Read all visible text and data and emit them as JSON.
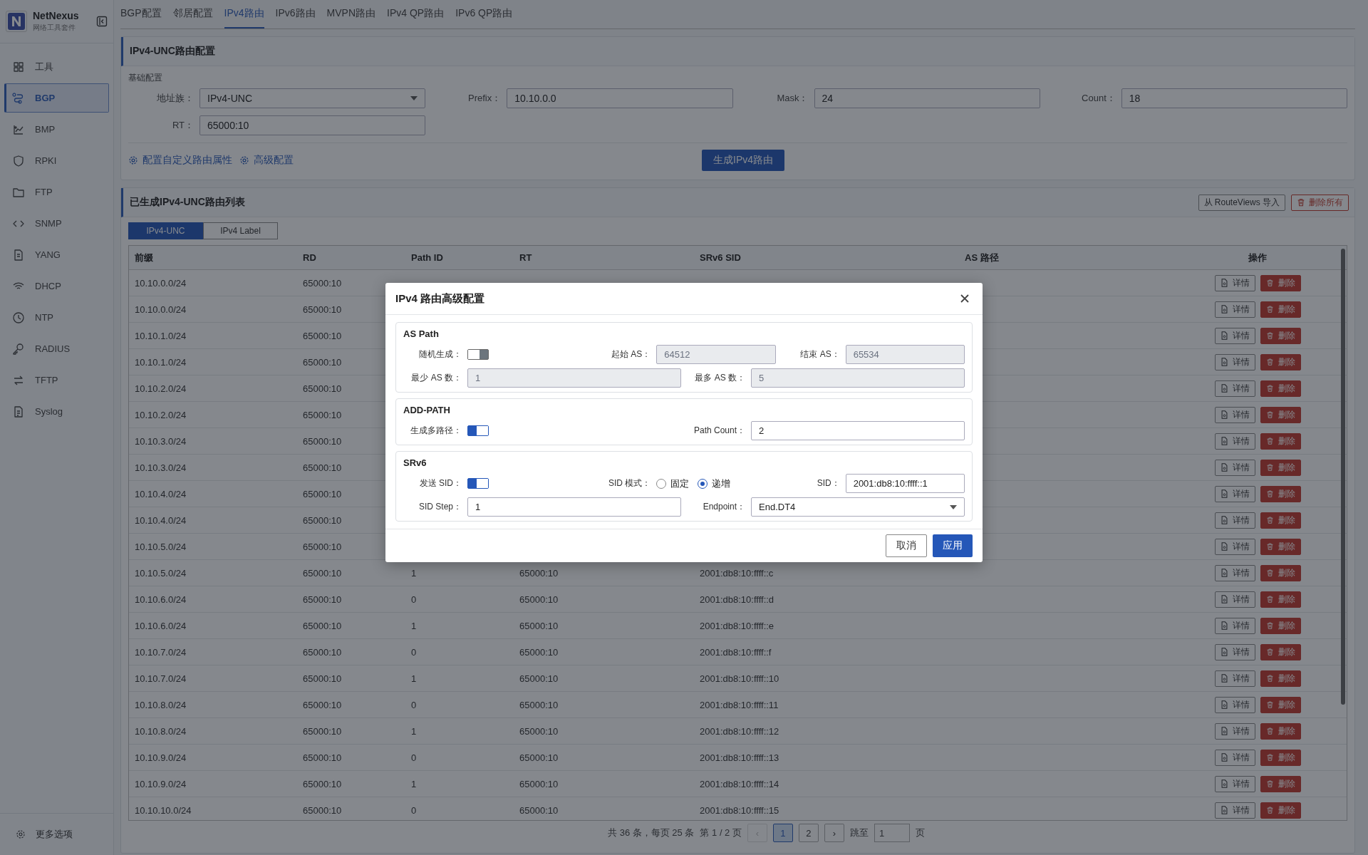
{
  "app": {
    "name": "NetNexus",
    "subtitle": "网络工具套件"
  },
  "sidebar": {
    "items": [
      {
        "label": "工具",
        "selected": false
      },
      {
        "label": "BGP",
        "selected": true
      },
      {
        "label": "BMP",
        "selected": false
      },
      {
        "label": "RPKI",
        "selected": false
      },
      {
        "label": "FTP",
        "selected": false
      },
      {
        "label": "SNMP",
        "selected": false
      },
      {
        "label": "YANG",
        "selected": false
      },
      {
        "label": "DHCP",
        "selected": false
      },
      {
        "label": "NTP",
        "selected": false
      },
      {
        "label": "RADIUS",
        "selected": false
      },
      {
        "label": "TFTP",
        "selected": false
      },
      {
        "label": "Syslog",
        "selected": false
      }
    ],
    "footer": "更多选项"
  },
  "tabs": [
    {
      "label": "BGP配置",
      "selected": false
    },
    {
      "label": "邻居配置",
      "selected": false
    },
    {
      "label": "IPv4路由",
      "selected": true
    },
    {
      "label": "IPv6路由",
      "selected": false
    },
    {
      "label": "MVPN路由",
      "selected": false
    },
    {
      "label": "IPv4 QP路由",
      "selected": false
    },
    {
      "label": "IPv6 QP路由",
      "selected": false
    }
  ],
  "config_card": {
    "title": "IPv4-UNC路由配置",
    "section": "基础配置",
    "fields": [
      {
        "kind": "select",
        "label": "地址族：",
        "value": "IPv4-UNC"
      },
      {
        "kind": "input",
        "label": "Prefix：",
        "value": "10.10.0.0"
      },
      {
        "kind": "input",
        "label": "Mask：",
        "value": "24"
      },
      {
        "kind": "input",
        "label": "Count：",
        "value": "18"
      },
      {
        "kind": "input",
        "label": "RT：",
        "value": "65000:10"
      }
    ],
    "links": [
      "配置自定义路由属性",
      "高级配置"
    ],
    "generate_button": "生成IPv4路由"
  },
  "list_card": {
    "title": "已生成IPv4-UNC路由列表",
    "import_button": "从 RouteViews 导入",
    "delete_all_button": "删除所有",
    "subtabs": [
      {
        "label": "IPv4-UNC",
        "selected": true
      },
      {
        "label": "IPv4 Label",
        "selected": false
      }
    ],
    "table": {
      "columns": [
        "前缀",
        "RD",
        "Path ID",
        "RT",
        "SRv6 SID",
        "AS 路径",
        "操作"
      ],
      "rows": [
        {
          "prefix": "10.10.0.0/24",
          "rd": "65000:10",
          "actions": [
            "详情",
            "删除"
          ]
        },
        {
          "prefix": "10.10.0.0/24",
          "rd": "65000:10",
          "actions": [
            "详情",
            "删除"
          ]
        },
        {
          "prefix": "10.10.1.0/24",
          "rd": "65000:10",
          "actions": [
            "详情",
            "删除"
          ]
        },
        {
          "prefix": "10.10.1.0/24",
          "rd": "65000:10",
          "actions": [
            "详情",
            "删除"
          ]
        },
        {
          "prefix": "10.10.2.0/24",
          "rd": "65000:10",
          "actions": [
            "详情",
            "删除"
          ]
        },
        {
          "prefix": "10.10.2.0/24",
          "rd": "65000:10",
          "actions": [
            "详情",
            "删除"
          ]
        },
        {
          "prefix": "10.10.3.0/24",
          "rd": "65000:10",
          "actions": [
            "详情",
            "删除"
          ]
        },
        {
          "prefix": "10.10.3.0/24",
          "rd": "65000:10",
          "actions": [
            "详情",
            "删除"
          ]
        },
        {
          "prefix": "10.10.4.0/24",
          "rd": "65000:10",
          "actions": [
            "详情",
            "删除"
          ]
        },
        {
          "prefix": "10.10.4.0/24",
          "rd": "65000:10",
          "actions": [
            "详情",
            "删除"
          ]
        },
        {
          "prefix": "10.10.5.0/24",
          "rd": "65000:10",
          "actions": [
            "详情",
            "删除"
          ]
        },
        {
          "prefix": "10.10.5.0/24",
          "rd": "65000:10",
          "path_id": "1",
          "rt": "65000:10",
          "sid": "2001:db8:10:ffff::c",
          "actions": [
            "详情",
            "删除"
          ]
        },
        {
          "prefix": "10.10.6.0/24",
          "rd": "65000:10",
          "path_id": "0",
          "rt": "65000:10",
          "sid": "2001:db8:10:ffff::d",
          "actions": [
            "详情",
            "删除"
          ]
        },
        {
          "prefix": "10.10.6.0/24",
          "rd": "65000:10",
          "path_id": "1",
          "rt": "65000:10",
          "sid": "2001:db8:10:ffff::e",
          "actions": [
            "详情",
            "删除"
          ]
        },
        {
          "prefix": "10.10.7.0/24",
          "rd": "65000:10",
          "path_id": "0",
          "rt": "65000:10",
          "sid": "2001:db8:10:ffff::f",
          "actions": [
            "详情",
            "删除"
          ]
        },
        {
          "prefix": "10.10.7.0/24",
          "rd": "65000:10",
          "path_id": "1",
          "rt": "65000:10",
          "sid": "2001:db8:10:ffff::10",
          "actions": [
            "详情",
            "删除"
          ]
        },
        {
          "prefix": "10.10.8.0/24",
          "rd": "65000:10",
          "path_id": "0",
          "rt": "65000:10",
          "sid": "2001:db8:10:ffff::11",
          "actions": [
            "详情",
            "删除"
          ]
        },
        {
          "prefix": "10.10.8.0/24",
          "rd": "65000:10",
          "path_id": "1",
          "rt": "65000:10",
          "sid": "2001:db8:10:ffff::12",
          "actions": [
            "详情",
            "删除"
          ]
        },
        {
          "prefix": "10.10.9.0/24",
          "rd": "65000:10",
          "path_id": "0",
          "rt": "65000:10",
          "sid": "2001:db8:10:ffff::13",
          "actions": [
            "详情",
            "删除"
          ]
        },
        {
          "prefix": "10.10.9.0/24",
          "rd": "65000:10",
          "path_id": "1",
          "rt": "65000:10",
          "sid": "2001:db8:10:ffff::14",
          "actions": [
            "详情",
            "删除"
          ]
        },
        {
          "prefix": "10.10.10.0/24",
          "rd": "65000:10",
          "path_id": "0",
          "rt": "65000:10",
          "sid": "2001:db8:10:ffff::15",
          "actions": [
            "详情",
            "删除"
          ]
        }
      ]
    },
    "pagination": {
      "summary": "共 36 条，每页 25 条",
      "page_info": "第 1 / 2 页",
      "prev": "‹",
      "prev_disabled": true,
      "pages": [
        {
          "label": "1",
          "selected": true
        },
        {
          "label": "2",
          "selected": false
        }
      ],
      "next": "›",
      "jump_label": "跳至",
      "jump_value": "1",
      "jump_suffix": "页"
    }
  },
  "modal": {
    "title": "IPv4 路由高级配置",
    "sections": [
      {
        "title": "AS Path",
        "rows": [
          [
            {
              "kind": "switch",
              "label": "随机生成：",
              "on": false
            },
            {
              "kind": "input",
              "label": "起始 AS：",
              "value": "64512",
              "disabled": true
            },
            {
              "kind": "input",
              "label": "结束 AS：",
              "value": "65534",
              "disabled": true
            }
          ],
          [
            {
              "kind": "input",
              "label": "最少 AS 数：",
              "value": "1",
              "disabled": true
            },
            {
              "kind": "input",
              "label": "最多 AS 数：",
              "value": "5",
              "disabled": true
            }
          ]
        ]
      },
      {
        "title": "ADD-PATH",
        "rows": [
          [
            {
              "kind": "switch",
              "label": "生成多路径：",
              "on": true
            },
            {
              "kind": "input",
              "label": "Path Count：",
              "value": "2",
              "disabled": false
            }
          ]
        ]
      },
      {
        "title": "SRv6",
        "rows": [
          [
            {
              "kind": "switch",
              "label": "发送 SID：",
              "on": true
            },
            {
              "kind": "radio",
              "label": "SID 模式：",
              "options": [
                {
                  "label": "固定",
                  "selected": false
                },
                {
                  "label": "递增",
                  "selected": true
                }
              ]
            },
            {
              "kind": "input",
              "label": "SID：",
              "value": "2001:db8:10:ffff::1",
              "disabled": false
            }
          ],
          [
            {
              "kind": "input",
              "label": "SID Step：",
              "value": "1",
              "disabled": false
            },
            {
              "kind": "select",
              "label": "Endpoint：",
              "value": "End.DT4"
            }
          ]
        ]
      }
    ],
    "cancel_button": "取消",
    "apply_button": "应用"
  }
}
